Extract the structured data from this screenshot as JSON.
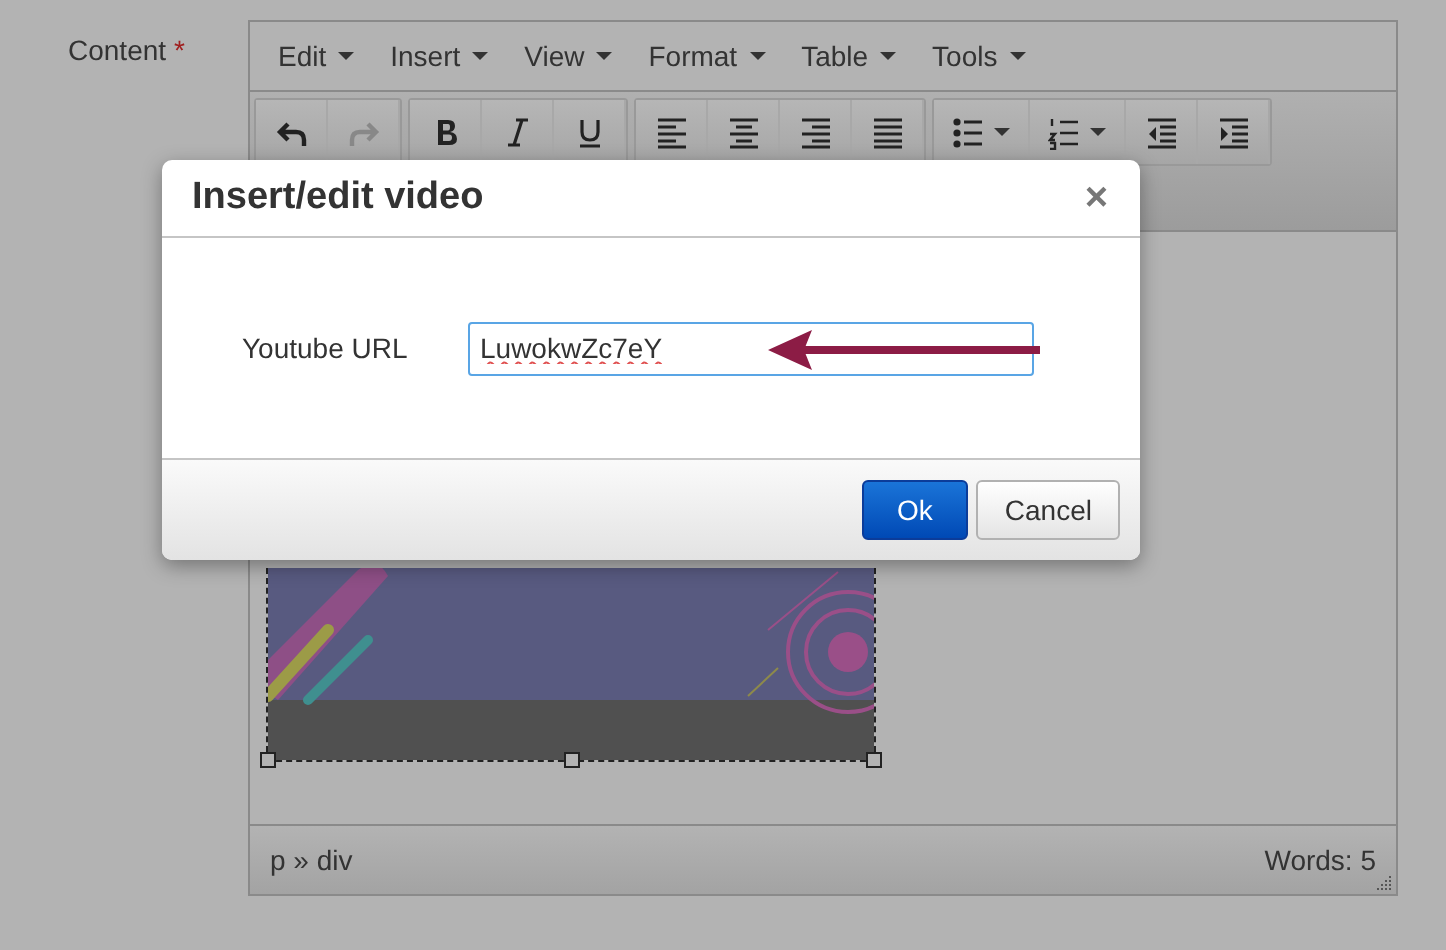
{
  "field_label": {
    "text": "Content",
    "required_mark": "*"
  },
  "editor": {
    "menus": [
      {
        "label": "Edit"
      },
      {
        "label": "Insert"
      },
      {
        "label": "View"
      },
      {
        "label": "Format"
      },
      {
        "label": "Table"
      },
      {
        "label": "Tools"
      }
    ],
    "toolbar": [
      [
        {
          "kind": "undo",
          "disabled": false
        },
        {
          "kind": "redo",
          "disabled": true
        }
      ],
      [
        {
          "kind": "bold",
          "disabled": false
        },
        {
          "kind": "italic",
          "disabled": false
        },
        {
          "kind": "underline",
          "disabled": false
        }
      ],
      [
        {
          "kind": "align-left",
          "disabled": false
        },
        {
          "kind": "align-center",
          "disabled": false
        },
        {
          "kind": "align-right",
          "disabled": false
        },
        {
          "kind": "justify",
          "disabled": false
        }
      ],
      [
        {
          "kind": "bullet-list",
          "disabled": false
        },
        {
          "kind": "numbered-list",
          "disabled": false
        },
        {
          "kind": "outdent",
          "disabled": false
        },
        {
          "kind": "indent",
          "disabled": false
        }
      ]
    ],
    "content": {
      "kind": "picture"
    },
    "status_bar": {
      "path": "p » div",
      "word_count": "Words: 5"
    }
  },
  "dialog": {
    "title": "Insert/edit video",
    "close": "×",
    "field": {
      "label": "Youtube URL",
      "value": "LuwokwZc7eY"
    },
    "buttons": [
      {
        "label": "Ok",
        "kind": "primary"
      },
      {
        "label": "Cancel",
        "kind": "secondary"
      }
    ]
  }
}
